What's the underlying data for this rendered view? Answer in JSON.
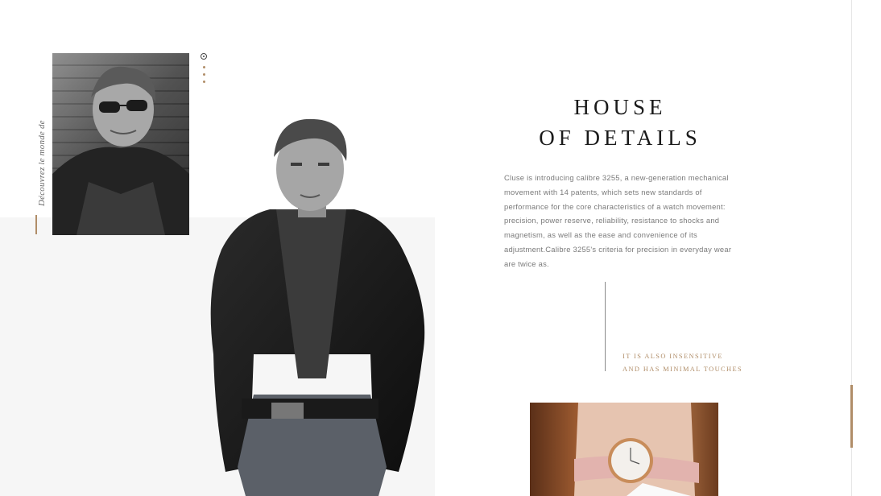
{
  "sidebar": {
    "caption": "Découvrez le monde de"
  },
  "slider": {
    "dot_count": 4,
    "active_index": 0
  },
  "images": {
    "portrait": "black-and-white portrait of a man in sunglasses and a denim jacket",
    "model": "black-and-white photo of a man in a dark blazer, hands in pockets",
    "watch": "wrist wearing a rose-gold watch with a pink leather strap"
  },
  "hero": {
    "title_line1": "HOUSE",
    "title_line2": "OF DETAILS",
    "body": "Cluse is introducing calibre 3255, a new-generation mechanical movement with 14 patents, which sets new standards of performance for the core characteristics of a watch movement: precision, power reserve, reliability, resistance to shocks and magnetism, as well as the ease and convenience of its adjustment.Calibre 3255's criteria for precision in everyday wear are twice as.",
    "tagline_line1": "IT IS ALSO INSENSITIVE",
    "tagline_line2": "AND HAS MINIMAL TOUCHES"
  },
  "colors": {
    "accent": "#b08d68",
    "text_dark": "#1a1a1a",
    "text_muted": "#7a7a7a",
    "band": "#f6f6f6"
  }
}
